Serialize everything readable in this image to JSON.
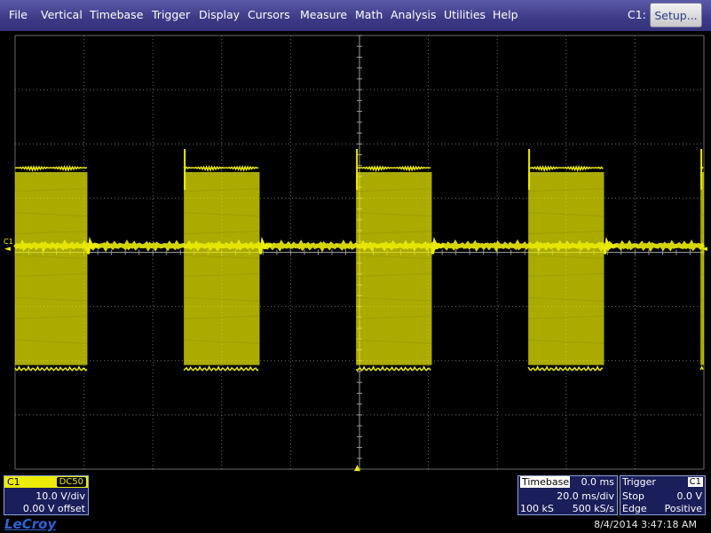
{
  "menu": {
    "items": [
      "File",
      "Vertical",
      "Timebase",
      "Trigger",
      "Display",
      "Cursors",
      "Measure",
      "Math",
      "Analysis",
      "Utilities",
      "Help"
    ]
  },
  "header": {
    "channel_label": "C1:",
    "setup_label": "Setup..."
  },
  "graticule": {
    "channel_marker": "C1",
    "colors": {
      "trace": "#ecec00",
      "grid": "#6a6a6a",
      "background": "#000000"
    }
  },
  "trace": {
    "description_of_signal": "burst",
    "bursts": [
      {
        "start_div": 0.0,
        "end_div": 1.05
      },
      {
        "start_div": 2.45,
        "end_div": 3.55
      },
      {
        "start_div": 4.95,
        "end_div": 6.05
      },
      {
        "start_div": 7.45,
        "end_div": 8.55
      },
      {
        "start_div": 9.95,
        "end_div": 10.0
      }
    ]
  },
  "channel_box": {
    "name": "C1",
    "coupling": "DC50",
    "volts_per_div": "10.0 V/div",
    "offset": "0.00 V offset"
  },
  "timebase_box": {
    "title": "Timebase",
    "position": "0.0 ms",
    "time_per_div": "20.0 ms/div",
    "samples": "100 kS",
    "sample_rate": "500 kS/s"
  },
  "trigger_box": {
    "title": "Trigger",
    "source": "C1",
    "mode": "Stop",
    "level": "0.0 V",
    "type": "Edge",
    "slope": "Positive"
  },
  "footer": {
    "logo": "LeCroy",
    "timestamp": "8/4/2014 3:47:18 AM"
  }
}
